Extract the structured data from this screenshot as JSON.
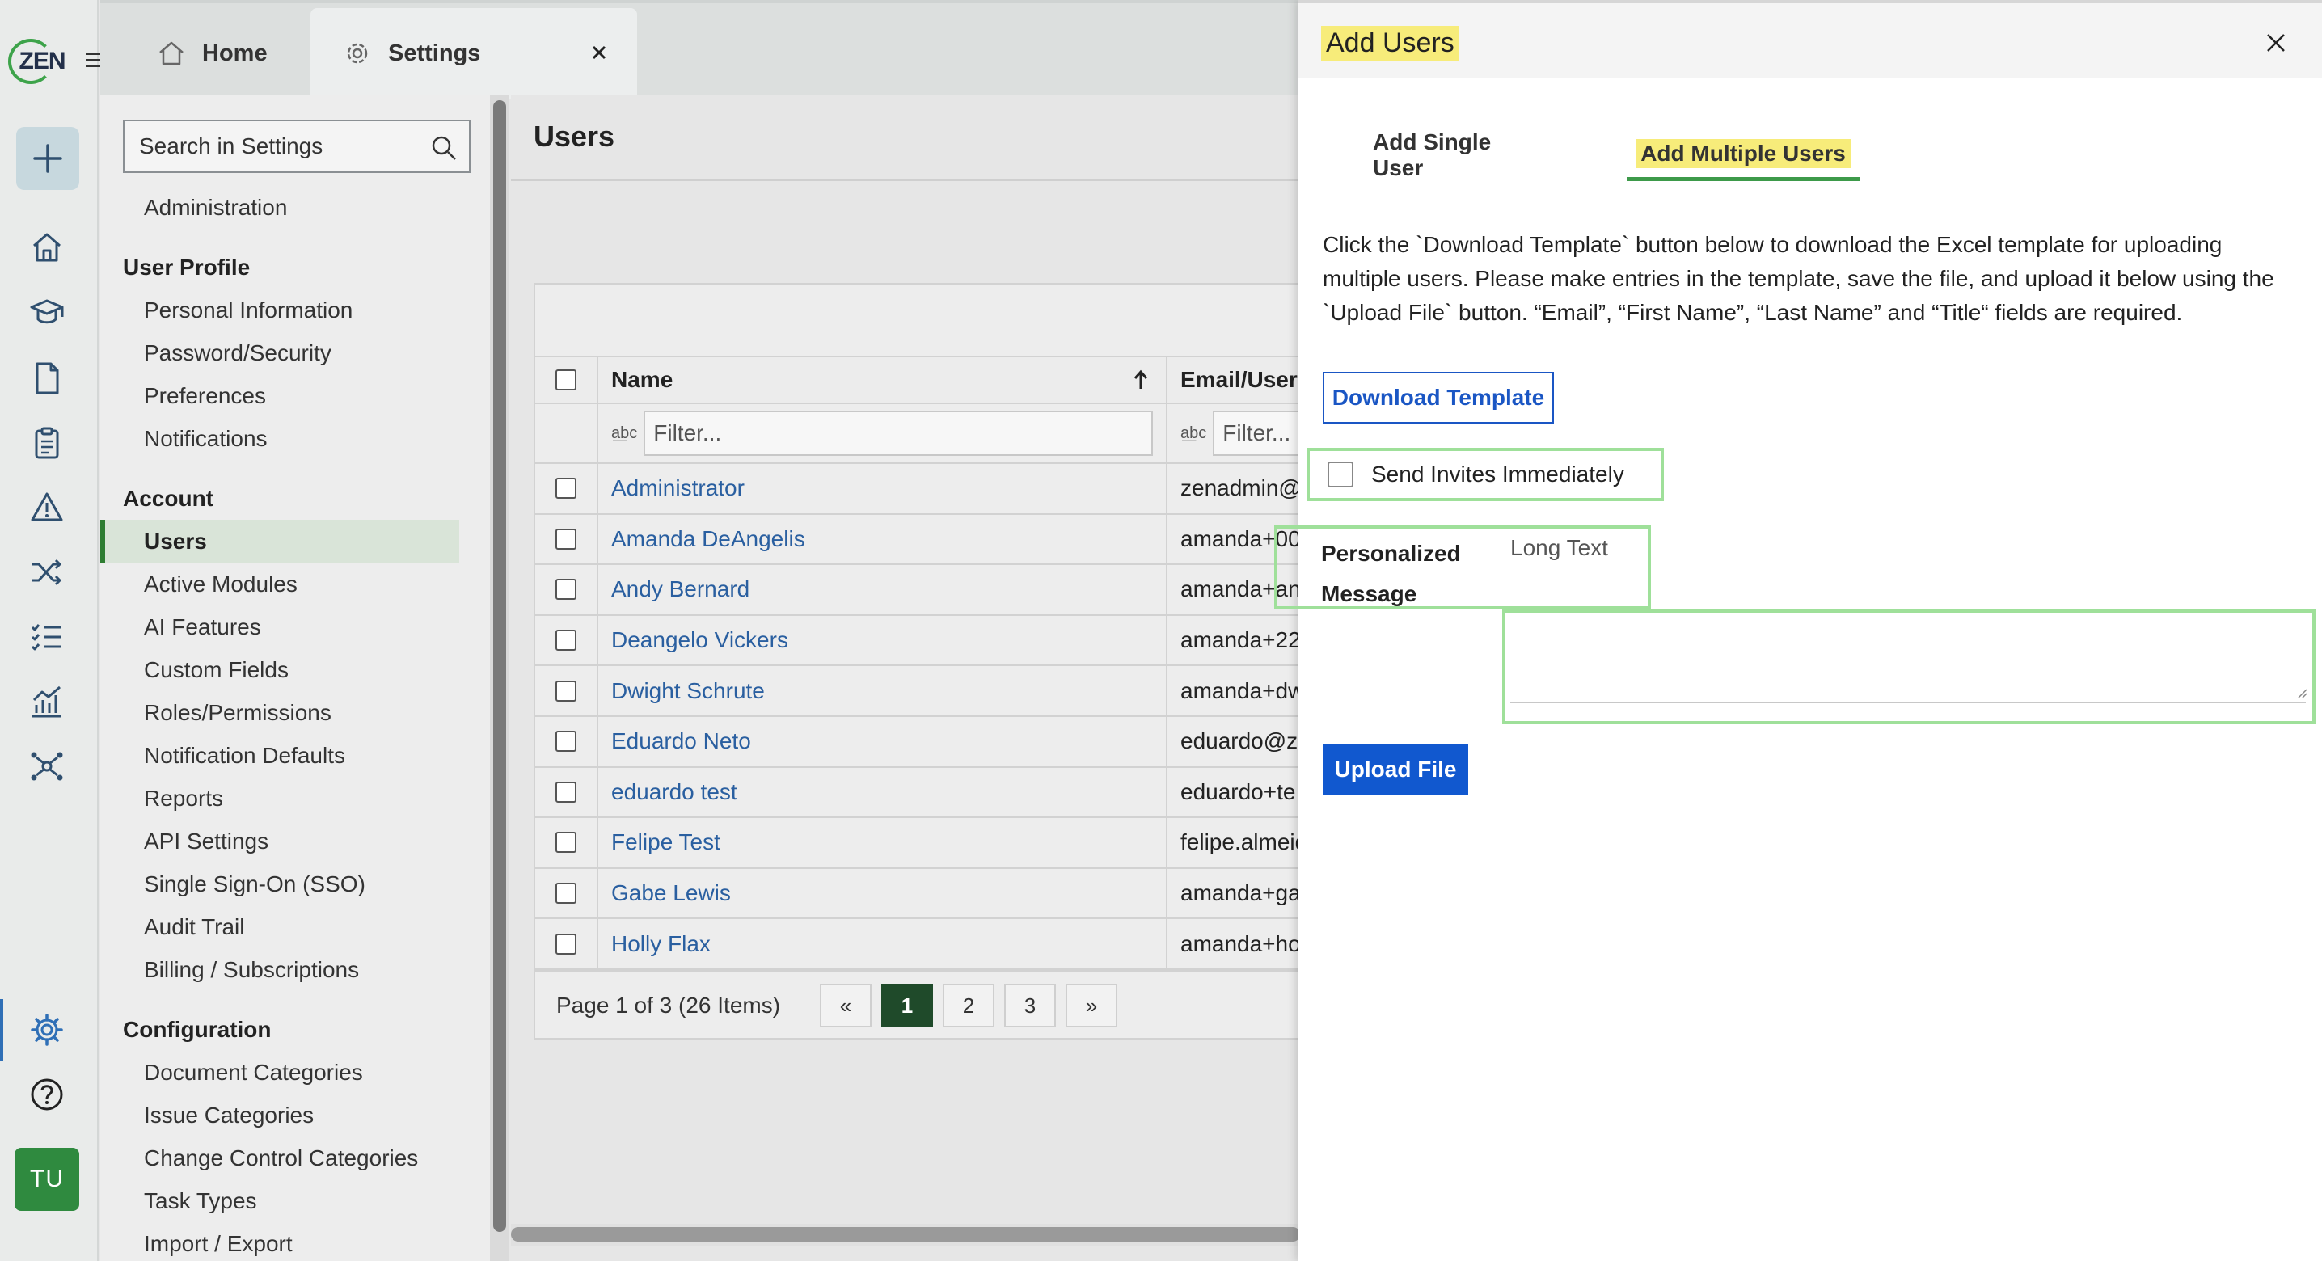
{
  "app": {
    "logo_text": "ZEN",
    "user_initials": "TU"
  },
  "tabs": [
    {
      "label": "Home",
      "icon": "home-icon"
    },
    {
      "label": "Settings",
      "icon": "gear-icon"
    }
  ],
  "rail_icons": [
    "plus-icon",
    "home-icon",
    "graduation-cap-icon",
    "document-icon",
    "clipboard-icon",
    "warning-icon",
    "shuffle-icon",
    "checklist-icon",
    "chart-icon",
    "network-icon",
    "gear-icon",
    "help-icon"
  ],
  "settings_nav": {
    "search_placeholder": "Search in Settings",
    "top_item": "Administration",
    "groups": [
      {
        "title": "User Profile",
        "items": [
          "Personal Information",
          "Password/Security",
          "Preferences",
          "Notifications"
        ]
      },
      {
        "title": "Account",
        "items": [
          "Users",
          "Active Modules",
          "AI Features",
          "Custom Fields",
          "Roles/Permissions",
          "Notification Defaults",
          "Reports",
          "API Settings",
          "Single Sign-On (SSO)",
          "Audit Trail",
          "Billing / Subscriptions"
        ]
      },
      {
        "title": "Configuration",
        "items": [
          "Document Categories",
          "Issue Categories",
          "Change Control Categories",
          "Task Types",
          "Import / Export"
        ]
      }
    ],
    "active_item": "Users"
  },
  "users_page": {
    "title": "Users",
    "columns": {
      "name": "Name",
      "email": "Email/Userl"
    },
    "filter_placeholder": "Filter...",
    "rows": [
      {
        "name": "Administrator",
        "email": "zenadmin@l"
      },
      {
        "name": "Amanda DeAngelis",
        "email": "amanda+00"
      },
      {
        "name": "Andy Bernard",
        "email": "amanda+an"
      },
      {
        "name": "Deangelo Vickers",
        "email": "amanda+22"
      },
      {
        "name": "Dwight Schrute",
        "email": "amanda+dw"
      },
      {
        "name": "Eduardo Neto",
        "email": "eduardo@ze"
      },
      {
        "name": "eduardo test",
        "email": "eduardo+te"
      },
      {
        "name": "Felipe Test",
        "email": "felipe.almeid"
      },
      {
        "name": "Gabe Lewis",
        "email": "amanda+gal"
      },
      {
        "name": "Holly Flax",
        "email": "amanda+ho"
      }
    ],
    "page_info": "Page 1 of 3 (26 Items)",
    "pager": {
      "prev": "«",
      "pages": [
        "1",
        "2",
        "3"
      ],
      "next": "»",
      "current": "1"
    }
  },
  "panel": {
    "title": "Add Users",
    "tab_single": "Add Single User",
    "tab_multiple": "Add Multiple Users",
    "instructions": "Click the `Download Template` button below to download the Excel template for uploading multiple users. Please make entries in the template, save the file, and upload it below using the `Upload File` button. “Email”, “First Name”, “Last Name” and “Title“ fields are required.",
    "download_button": "Download Template",
    "send_invites_label": "Send Invites Immediately",
    "message_label": "Personalized Message",
    "message_hint": "Long Text",
    "upload_button": "Upload File"
  },
  "colors": {
    "accent_green": "#2e7d32",
    "primary_blue": "#1158cf",
    "link_blue": "#2a5fa0",
    "highlight_yellow": "#f7ec7a",
    "annotation_green": "#9fe09a"
  }
}
